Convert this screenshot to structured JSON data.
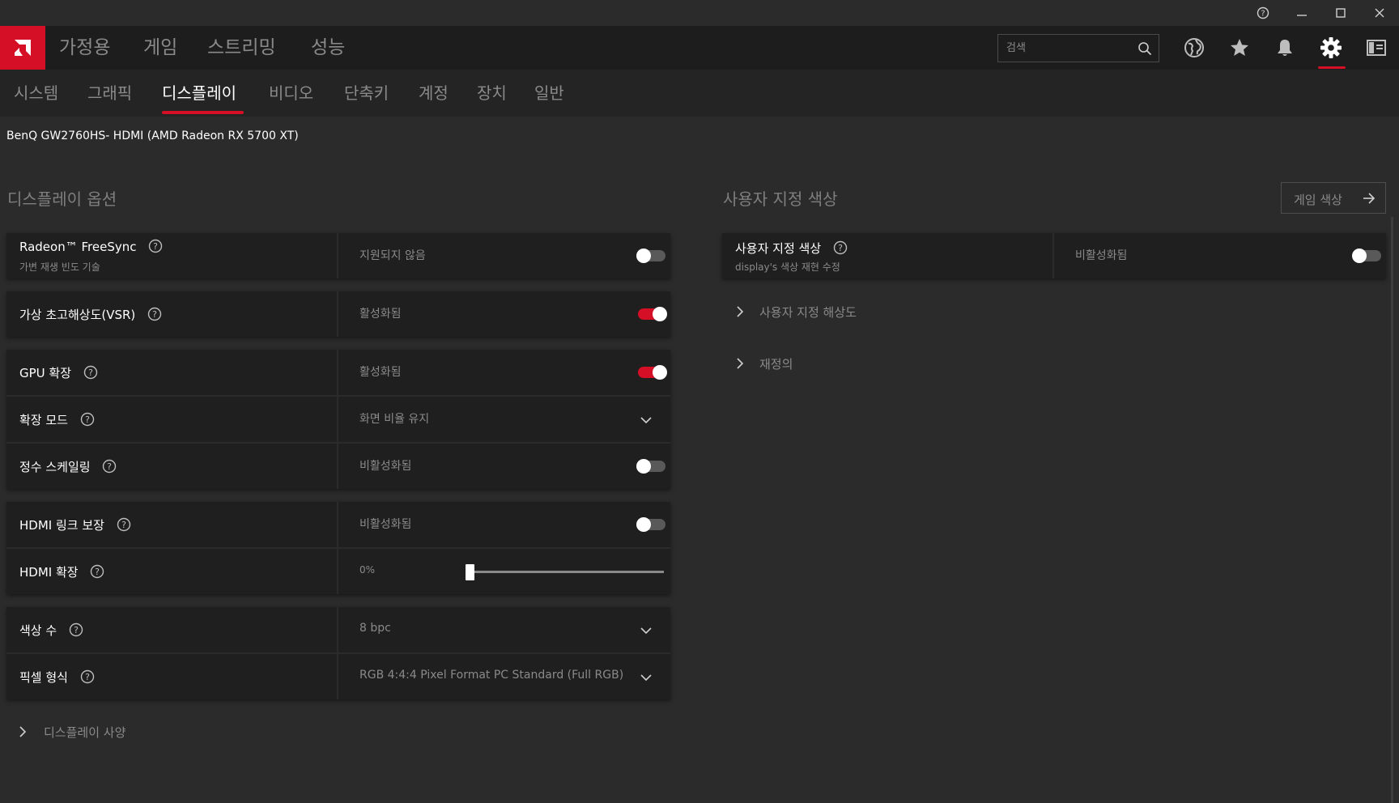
{
  "window": {
    "help_icon": "help-circle-icon",
    "minimize_icon": "minimize-icon",
    "maximize_icon": "maximize-icon",
    "close_icon": "close-icon"
  },
  "topnav": {
    "brand_icon": "amd-logo",
    "items": [
      "가정용",
      "게임",
      "스트리밍",
      "성능"
    ],
    "search_placeholder": "검색",
    "icons": [
      "globe-icon",
      "star-icon",
      "bell-icon",
      "gear-icon",
      "sidebar-icon"
    ]
  },
  "subnav": {
    "items": [
      "시스템",
      "그래픽",
      "디스플레이",
      "비디오",
      "단축키",
      "계정",
      "장치",
      "일반"
    ],
    "active": "디스플레이"
  },
  "device": "BenQ GW2760HS- HDMI (AMD Radeon RX 5700 XT)",
  "display_options": {
    "title": "디스플레이 옵션",
    "freesync": {
      "label": "Radeon™ FreeSync",
      "sublabel": "가변 재생 빈도 기술",
      "value": "지원되지 않음",
      "enabled": false
    },
    "vsr": {
      "label": "가상 초고해상도(VSR)",
      "value": "활성화됨",
      "enabled": true
    },
    "gpu_scaling": {
      "label": "GPU 확장",
      "value": "활성화됨",
      "enabled": true
    },
    "scaling_mode": {
      "label": "확장 모드",
      "value": "화면 비율 유지"
    },
    "integer_scaling": {
      "label": "정수 스케일링",
      "value": "비활성화됨",
      "enabled": false
    },
    "hdmi_link": {
      "label": "HDMI 링크 보장",
      "value": "비활성화됨",
      "enabled": false
    },
    "hdmi_scaling": {
      "label": "HDMI 확장",
      "value": "0%",
      "level": 0
    },
    "color_depth": {
      "label": "색상 수",
      "value": "8 bpc"
    },
    "pixel_format": {
      "label": "픽셀 형식",
      "value": "RGB 4:4:4 Pixel Format PC Standard (Full RGB)"
    },
    "specs_expander": "디스플레이 사양"
  },
  "custom_color": {
    "title": "사용자 지정 색상",
    "game_color_button": "게임 색상",
    "row": {
      "label": "사용자 지정 색상",
      "sublabel": "display's 색상 재현 수정",
      "value": "비활성화됨",
      "enabled": false
    },
    "custom_resolution": "사용자 지정 해상도",
    "overrides": "재정의"
  },
  "colors": {
    "accent": "#d50f25",
    "background": "#2b2b2b",
    "panel": "#1f1f1f"
  }
}
